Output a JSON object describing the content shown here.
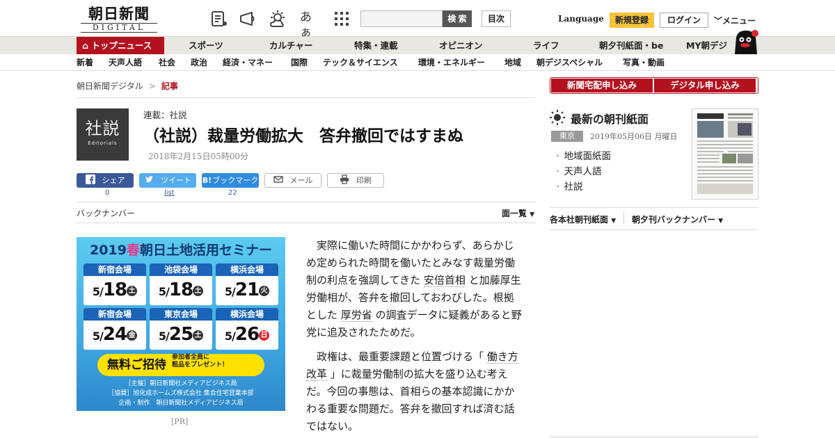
{
  "header": {
    "logo_jp": "朝日新聞",
    "logo_en": "DIGITAL",
    "search_button": "検 索",
    "mokuji": "目次",
    "language": "Language",
    "signup": "新規登録",
    "login": "ログイン",
    "menu": "メニュー",
    "font_icon_text": "あぁ"
  },
  "nav_primary": [
    {
      "label": "トップニュース"
    },
    {
      "label": "スポーツ"
    },
    {
      "label": "カルチャー"
    },
    {
      "label": "特集・連載"
    },
    {
      "label": "オピニオン"
    },
    {
      "label": "ライフ"
    },
    {
      "label": "朝夕刊紙面・be"
    },
    {
      "label": "MY朝デジ"
    }
  ],
  "nav_secondary": [
    {
      "label": "新着"
    },
    {
      "label": "天声人語"
    },
    {
      "label": "社会"
    },
    {
      "label": "政治"
    },
    {
      "label": "経済・マネー"
    },
    {
      "label": "国際"
    },
    {
      "label": "テック＆サイエンス"
    },
    {
      "label": "環境・エネルギー"
    },
    {
      "label": "地域"
    },
    {
      "label": "朝デジスペシャル"
    },
    {
      "label": "写真・動画"
    }
  ],
  "breadcrumb": {
    "home": "朝日新聞デジタル",
    "sep": ">",
    "current": "記事"
  },
  "article": {
    "thumb_jp": "社説",
    "thumb_en": "Editorials",
    "series": "連載：社説",
    "title": "（社説）裁量労働拡大　答弁撤回ではすまぬ",
    "date": "2018年2月15日05時00分",
    "p1_a": "実際に働いた時間にかかわらず、あらかじめ定められた時間を働いたとみなす裁量労働制の利点を強調してきた",
    "p1_link1": "安倍首相",
    "p1_b": "と加藤厚生労働相が、答弁を撤回しておわびした。根拠とした",
    "p1_link2": "厚労省",
    "p1_c": "の調査データに疑義があると野党に追及されたためだ。",
    "p2_a": "政権は、最重要課題と位置づける「",
    "p2_link": "働き方改革",
    "p2_b": "」に裁量労働制の拡大を盛り込む考えだ。今回の事態は、首相らの基本認識にかかわる重要な問題だ。答弁を撤回すれば済む話ではない。"
  },
  "share": {
    "facebook": "シェア",
    "facebook_count": "0",
    "twitter": "ツイート",
    "twitter_count": "list",
    "hatena": "ブックマーク",
    "hatena_count": "22",
    "mail": "メール",
    "print": "印刷"
  },
  "backnumber": {
    "label": "バックナンバー",
    "menu": "面一覧"
  },
  "ad": {
    "year": "2019",
    "season": "春",
    "heading": "朝日土地活用セミナー",
    "venues": [
      {
        "name": "新宿会場",
        "month": "5",
        "day": "18",
        "dow": "土",
        "holiday": false
      },
      {
        "name": "池袋会場",
        "month": "5",
        "day": "18",
        "dow": "土",
        "holiday": false
      },
      {
        "name": "横浜会場",
        "month": "5",
        "day": "21",
        "dow": "火",
        "holiday": false
      },
      {
        "name": "新宿会場",
        "month": "5",
        "day": "24",
        "dow": "金",
        "holiday": false
      },
      {
        "name": "東京会場",
        "month": "5",
        "day": "25",
        "dow": "土",
        "holiday": false
      },
      {
        "name": "横浜会場",
        "month": "5",
        "day": "26",
        "dow": "日",
        "holiday": true
      }
    ],
    "free": "無料ご招待",
    "free_sub1": "参加者全員に",
    "free_sub2": "粗品をプレゼント！",
    "foot1": "［主催］朝日新聞社メディアビジネス局",
    "foot2": "［協賛］旭化成ホームズ株式会社 集合住宅営業本部",
    "foot3": "企画・制作　朝日新聞社メディアビジネス局",
    "pr": "[PR]"
  },
  "sidebar": {
    "subscribe_paper": "新聞宅配申し込み",
    "subscribe_digital": "デジタル申し込み",
    "latest": "最新の朝刊紙面",
    "edition": "東京",
    "paper_date": "2019年05月06日 月曜日",
    "links": [
      "地域面紙面",
      "天声人語",
      "社説"
    ],
    "honsha": "各本社朝刊紙面",
    "back": "朝夕刊バックナンバー"
  },
  "colors": {
    "brand_red": "#b4111f",
    "signup_yellow": "#f5c33b",
    "facebook": "#3b5998",
    "twitter": "#55acee",
    "hatena": "#2f8be0"
  }
}
